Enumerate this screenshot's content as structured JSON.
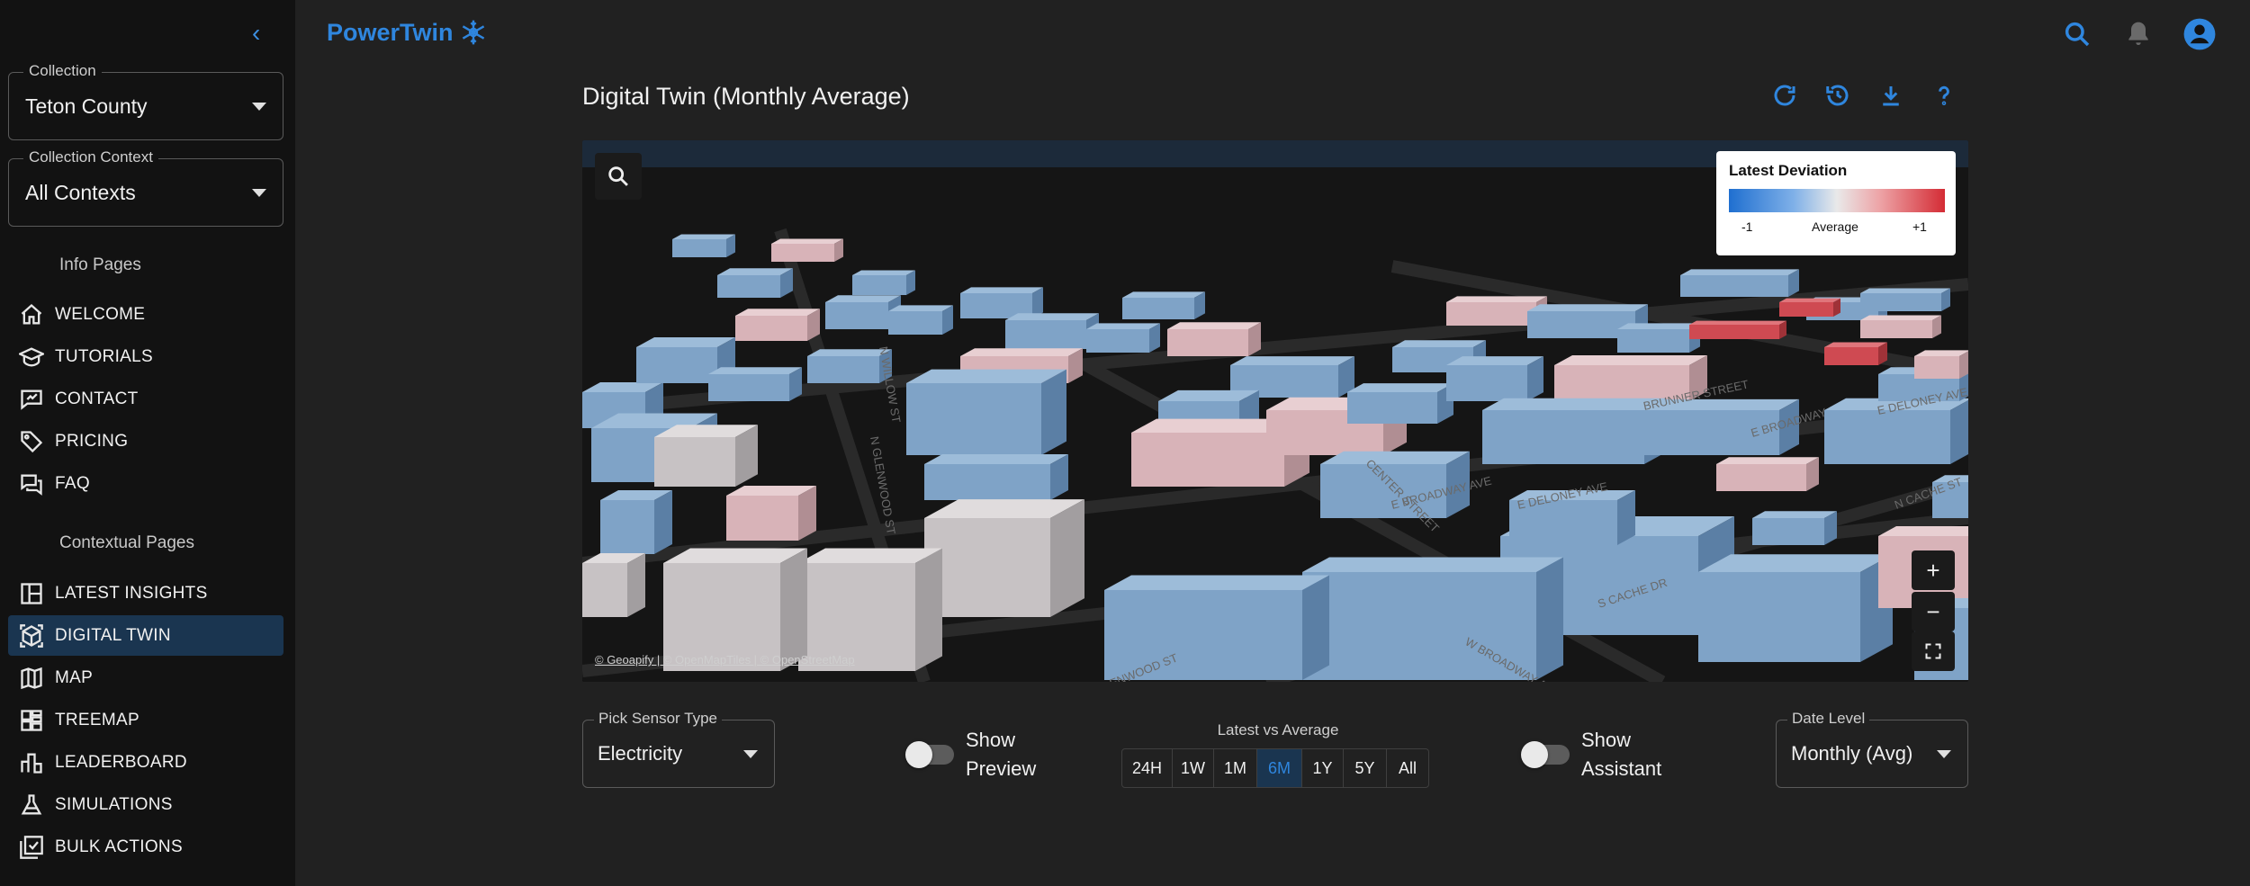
{
  "app": {
    "brand": "PowerTwin"
  },
  "sidebar": {
    "collection": {
      "label": "Collection",
      "value": "Teton County"
    },
    "context": {
      "label": "Collection Context",
      "value": "All Contexts"
    },
    "info_heading": "Info Pages",
    "info_items": [
      {
        "label": "WELCOME",
        "icon": "home-icon"
      },
      {
        "label": "TUTORIALS",
        "icon": "school-icon"
      },
      {
        "label": "CONTACT",
        "icon": "contact-form-icon"
      },
      {
        "label": "PRICING",
        "icon": "tag-icon"
      },
      {
        "label": "FAQ",
        "icon": "forum-icon"
      }
    ],
    "context_heading": "Contextual Pages",
    "context_items": [
      {
        "label": "LATEST INSIGHTS",
        "icon": "dashboard-icon"
      },
      {
        "label": "DIGITAL TWIN",
        "icon": "digital-twin-icon",
        "active": true
      },
      {
        "label": "MAP",
        "icon": "map-icon"
      },
      {
        "label": "TREEMAP",
        "icon": "treemap-icon"
      },
      {
        "label": "LEADERBOARD",
        "icon": "leaderboard-icon"
      },
      {
        "label": "SIMULATIONS",
        "icon": "flask-icon"
      },
      {
        "label": "BULK ACTIONS",
        "icon": "checklist-icon"
      }
    ]
  },
  "main": {
    "title": "Digital Twin (Monthly Average)",
    "legend": {
      "title": "Latest Deviation",
      "min": "-1",
      "mid": "Average",
      "max": "+1"
    },
    "attribution": "© Geoapify | © OpenMapTiles | © OpenStreetMap",
    "zoom": {
      "in": "+",
      "out": "−"
    },
    "streets": [
      "N GLENWOOD ST",
      "N GLENWOOD ST",
      "W BROADWAY AVE",
      "S CACHE DR",
      "E BROADWAY AVE",
      "E DELONEY AVE",
      "CENTER STREET",
      "N CACHE ST",
      "E BROADWAY",
      "E DELONEY AVE",
      "BRUNNER STREET",
      "N WILLOW ST"
    ]
  },
  "controls": {
    "sensor": {
      "label": "Pick Sensor Type",
      "value": "Electricity"
    },
    "preview_toggle": {
      "line1": "Show",
      "line2": "Preview",
      "on": false
    },
    "range": {
      "caption": "Latest vs Average",
      "options": [
        "24H",
        "1W",
        "1M",
        "6M",
        "1Y",
        "5Y",
        "All"
      ],
      "selected": "6M"
    },
    "assistant_toggle": {
      "line1": "Show",
      "line2": "Assistant",
      "on": false
    },
    "date_level": {
      "label": "Date Level",
      "value": "Monthly (Avg)"
    }
  },
  "colors": {
    "accent": "#2f86de",
    "active_bg": "#1a3550",
    "cool": "#7fa6cc",
    "warm": "#d9a3a8",
    "hot": "#d03a42"
  }
}
